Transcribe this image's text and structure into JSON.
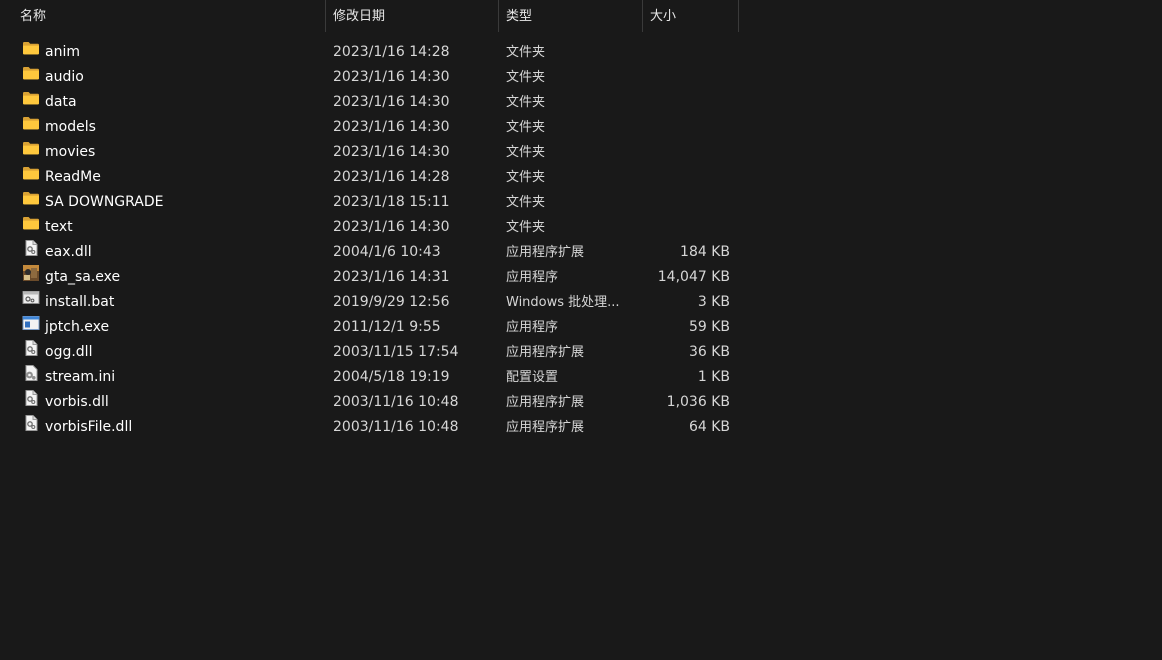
{
  "columns": {
    "name": "名称",
    "date": "修改日期",
    "type": "类型",
    "size": "大小"
  },
  "files": [
    {
      "name": "anim",
      "date": "2023/1/16 14:28",
      "type": "文件夹",
      "size": "",
      "icon": "folder-icon"
    },
    {
      "name": "audio",
      "date": "2023/1/16 14:30",
      "type": "文件夹",
      "size": "",
      "icon": "folder-icon"
    },
    {
      "name": "data",
      "date": "2023/1/16 14:30",
      "type": "文件夹",
      "size": "",
      "icon": "folder-icon"
    },
    {
      "name": "models",
      "date": "2023/1/16 14:30",
      "type": "文件夹",
      "size": "",
      "icon": "folder-icon"
    },
    {
      "name": "movies",
      "date": "2023/1/16 14:30",
      "type": "文件夹",
      "size": "",
      "icon": "folder-icon"
    },
    {
      "name": "ReadMe",
      "date": "2023/1/16 14:28",
      "type": "文件夹",
      "size": "",
      "icon": "folder-icon"
    },
    {
      "name": "SA DOWNGRADE",
      "date": "2023/1/18 15:11",
      "type": "文件夹",
      "size": "",
      "icon": "folder-icon"
    },
    {
      "name": "text",
      "date": "2023/1/16 14:30",
      "type": "文件夹",
      "size": "",
      "icon": "folder-icon"
    },
    {
      "name": "eax.dll",
      "date": "2004/1/6 10:43",
      "type": "应用程序扩展",
      "size": "184 KB",
      "icon": "dll-file-icon"
    },
    {
      "name": "gta_sa.exe",
      "date": "2023/1/16 14:31",
      "type": "应用程序",
      "size": "14,047 KB",
      "icon": "gta-app-icon"
    },
    {
      "name": "install.bat",
      "date": "2019/9/29 12:56",
      "type": "Windows 批处理...",
      "size": "3 KB",
      "icon": "batch-file-icon"
    },
    {
      "name": "jptch.exe",
      "date": "2011/12/1 9:55",
      "type": "应用程序",
      "size": "59 KB",
      "icon": "exe-window-icon"
    },
    {
      "name": "ogg.dll",
      "date": "2003/11/15 17:54",
      "type": "应用程序扩展",
      "size": "36 KB",
      "icon": "dll-file-icon"
    },
    {
      "name": "stream.ini",
      "date": "2004/5/18 19:19",
      "type": "配置设置",
      "size": "1 KB",
      "icon": "ini-file-icon"
    },
    {
      "name": "vorbis.dll",
      "date": "2003/11/16 10:48",
      "type": "应用程序扩展",
      "size": "1,036 KB",
      "icon": "dll-file-icon"
    },
    {
      "name": "vorbisFile.dll",
      "date": "2003/11/16 10:48",
      "type": "应用程序扩展",
      "size": "64 KB",
      "icon": "dll-file-icon"
    }
  ]
}
